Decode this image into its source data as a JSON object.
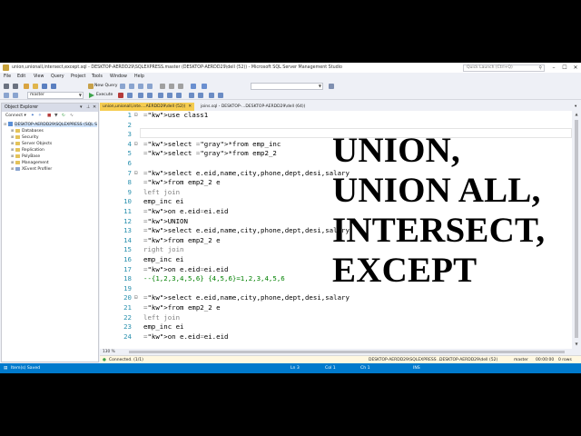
{
  "window": {
    "title": "union,unionall,intersect,except.sql - DESKTOP-AERDD29\\SQLEXPRESS.master (DESKTOP-AERDD29\\dell (52)) - Microsoft SQL Server Management Studio",
    "quick_launch_placeholder": "Quick Launch (Ctrl+Q)"
  },
  "menu": [
    "File",
    "Edit",
    "View",
    "Query",
    "Project",
    "Tools",
    "Window",
    "Help"
  ],
  "toolbar": {
    "new_query": "New Query",
    "database_combo": "master",
    "execute": "Execute"
  },
  "object_explorer": {
    "title": "Object Explorer",
    "connect": "Connect ▾",
    "server": "DESKTOP-AERDD29\\SQLEXPRESS (SQL S",
    "nodes": [
      "Databases",
      "Security",
      "Server Objects",
      "Replication",
      "PolyBase",
      "Management",
      "XEvent Profiler"
    ]
  },
  "tabs": [
    {
      "label": "union,unionall,inte....AERDD29\\dell (52))",
      "active": true
    },
    {
      "label": "joins.sql - DESKTOP-...DESKTOP-AERDD29\\dell (64))",
      "active": false
    }
  ],
  "editor": {
    "lines": [
      {
        "n": "1",
        "text": "use class1"
      },
      {
        "n": "2",
        "text": ""
      },
      {
        "n": "3",
        "text": ""
      },
      {
        "n": "4",
        "text": "select *from emp_inc"
      },
      {
        "n": "5",
        "text": "select *from emp2_2"
      },
      {
        "n": "6",
        "text": ""
      },
      {
        "n": "7",
        "text": "select e.eid,name,city,phone,dept,desi,salary"
      },
      {
        "n": "8",
        "text": "from emp2_2 e"
      },
      {
        "n": "9",
        "text": "left join"
      },
      {
        "n": "10",
        "text": "emp_inc ei"
      },
      {
        "n": "11",
        "text": "on e.eid=ei.eid"
      },
      {
        "n": "12",
        "text": "UNION"
      },
      {
        "n": "13",
        "text": "select e.eid,name,city,phone,dept,desi,salary"
      },
      {
        "n": "14",
        "text": "from emp2_2 e"
      },
      {
        "n": "15",
        "text": "right join"
      },
      {
        "n": "16",
        "text": "emp_inc ei"
      },
      {
        "n": "17",
        "text": "on e.eid=ei.eid"
      },
      {
        "n": "18",
        "text": "--{1,2,3,4,5,6} {4,5,6}=1,2,3,4,5,6"
      },
      {
        "n": "19",
        "text": ""
      },
      {
        "n": "20",
        "text": "select e.eid,name,city,phone,dept,desi,salary"
      },
      {
        "n": "21",
        "text": "from emp2_2 e"
      },
      {
        "n": "22",
        "text": "left join"
      },
      {
        "n": "23",
        "text": "emp_inc ei"
      },
      {
        "n": "24",
        "text": "on e.eid=ei.eid"
      }
    ]
  },
  "overlay": {
    "line1": "UNION,",
    "line2": "UNION ALL,",
    "line3": "INTERSECT,",
    "line4": "EXCEPT"
  },
  "zoom": "130 %",
  "query_status": {
    "connected": "Connected. (1/1)",
    "server": "DESKTOP-AERDD29\\SQLEXPRESS ...",
    "user": "DESKTOP-AERDD29\\dell (52)",
    "database": "master",
    "time": "00:00:00",
    "rows": "0 rows"
  },
  "status": {
    "left": "Item(s) Saved",
    "ln": "Ln 3",
    "col": "Col 1",
    "ch": "Ch 1",
    "mode": "INS"
  },
  "colors": {
    "keyword": "#0000ff",
    "comment": "#008000",
    "line_number": "#2b91af",
    "status_bar": "#007acc",
    "active_tab": "#f5cc50"
  }
}
